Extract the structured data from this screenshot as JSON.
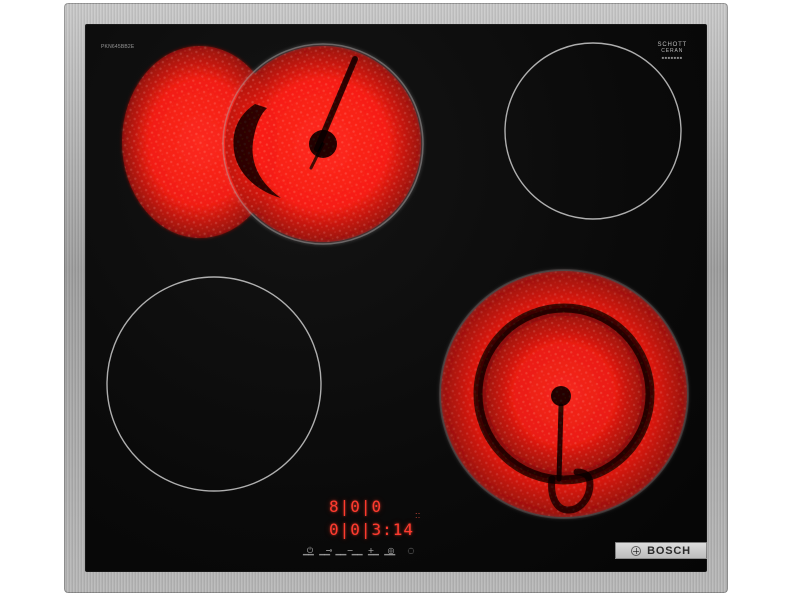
{
  "colors": {
    "frame_light": "#c9c9c9",
    "frame_dark": "#9c9c9c",
    "glass": "#0a0a0a",
    "heat_red": "#ff2a1f",
    "ring_line": "#cfcfcf",
    "display_red": "#ff3b2f"
  },
  "tiny_text_top_left": "PKN645BB2E",
  "schott": {
    "line1": "SCHOTT",
    "line2": "CERAN",
    "line3": "■■■■■■■"
  },
  "display": {
    "row1": "8|0|0",
    "row2": "0|0|3:14",
    "indicator_hint": "::"
  },
  "controls": {
    "power_symbol": "⏻",
    "key_symbol": "⊸",
    "minus": "−",
    "plus": "+",
    "timer_symbol": "◎",
    "select_symbol": "◌"
  },
  "bars": "▁▁ ▁▁ ▁▁ ▁▁ ▁▁ ▁▁",
  "brand": {
    "name": "BOSCH"
  }
}
